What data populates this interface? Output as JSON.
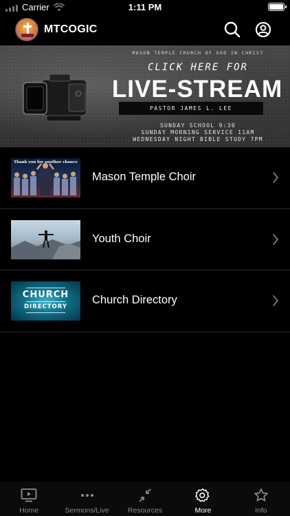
{
  "status_bar": {
    "carrier": "Carrier",
    "time": "1:11 PM"
  },
  "header": {
    "title": "MTCOGIC",
    "search_icon": "search-icon",
    "account_icon": "account-icon"
  },
  "banner": {
    "org": "MASON TEMPLE CHURCH OF GOD IN CHRIST",
    "cta": "CLICK HERE FOR",
    "headline": "LIVE-STREAM",
    "pastor": "PASTOR JAMES L. LEE",
    "schedule": [
      "SUNDAY SCHOOL 9:30",
      "SUNDAY MORNING SERVICE 11AM",
      "WEDNESDAY NIGHT BIBLE STUDY 7PM"
    ]
  },
  "list": {
    "items": [
      {
        "label": "Mason Temple Choir",
        "thumb_caption": "Thank you for another chance"
      },
      {
        "label": "Youth Choir"
      },
      {
        "label": "Church Directory",
        "thumb_line1": "CHURCH",
        "thumb_line2": "DIRECTORY"
      }
    ]
  },
  "tab_bar": {
    "tabs": [
      {
        "label": "Home",
        "icon": "tv-play-icon"
      },
      {
        "label": "Sermons/Live",
        "icon": "more-dots-icon"
      },
      {
        "label": "Resources",
        "icon": "shrink-arrows-icon"
      },
      {
        "label": "More",
        "icon": "gear-icon",
        "active": true
      },
      {
        "label": "Info",
        "icon": "star-icon"
      }
    ]
  },
  "colors": {
    "background": "#000000",
    "tab_active": "#ffffff",
    "tab_inactive": "#8e8e8e",
    "divider": "#2a2a2a"
  }
}
